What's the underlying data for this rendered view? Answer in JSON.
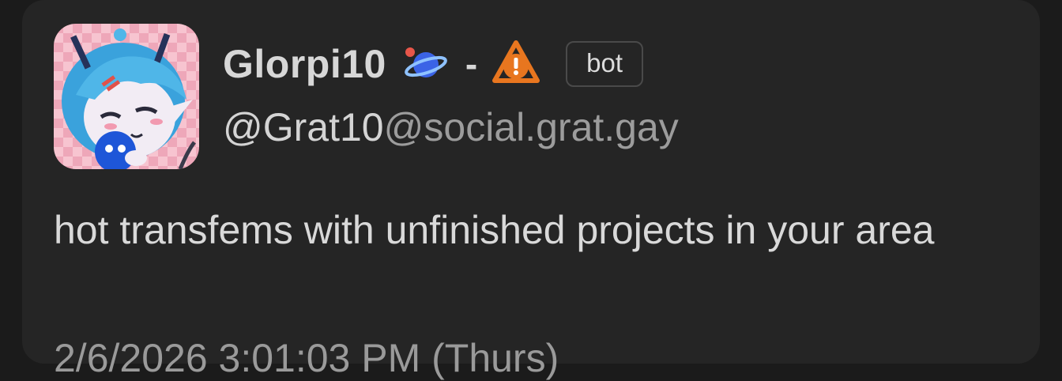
{
  "post": {
    "display_name": "Glorpi10",
    "separator": "-",
    "badge": "bot",
    "handle_user": "@Grat10",
    "handle_domain": "@social.grat.gay",
    "content": "hot transfems with unfinished projects in your area",
    "timestamp": "2/6/2026 3:01:03 PM (Thurs)",
    "emojis": [
      "planet-icon",
      "warning-icon"
    ]
  },
  "colors": {
    "background": "#1b1b1b",
    "card": "#252525",
    "text_primary": "#d7d7d7",
    "text_secondary": "#9c9c9c",
    "warning_orange": "#e8761f",
    "planet_blue": "#3b63e6",
    "avatar_hair": "#4fb6e8",
    "avatar_bg_pink": "#f4b8c6"
  }
}
